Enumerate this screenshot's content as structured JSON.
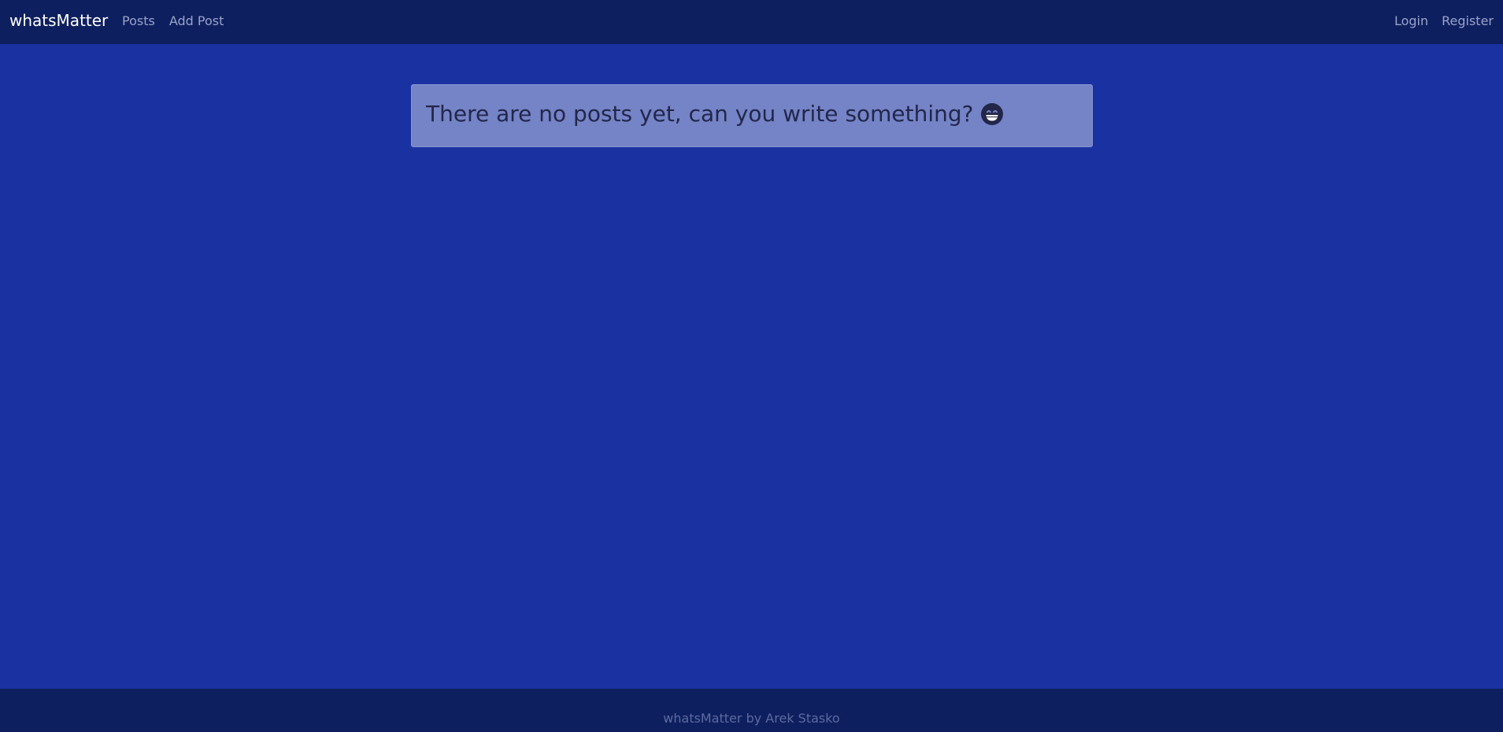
{
  "navbar": {
    "brand": "whatsMatter",
    "left_links": [
      "Posts",
      "Add Post"
    ],
    "right_links": [
      "Login",
      "Register"
    ]
  },
  "main": {
    "empty_message": "There are no posts yet, can you write something?",
    "emoji_icon": "grinning-face-icon"
  },
  "footer": {
    "text": "whatsMatter by Arek Stasko"
  },
  "colors": {
    "page_background": "#1a31a1",
    "navbar_background": "#0e1f60",
    "alert_background": "#7583c7"
  }
}
